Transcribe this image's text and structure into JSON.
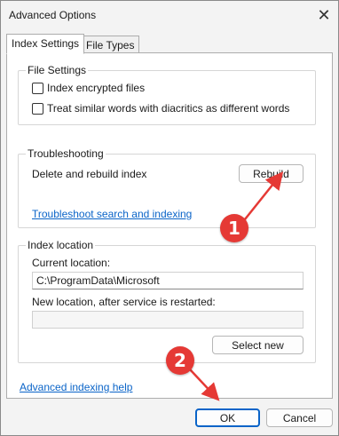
{
  "window": {
    "title": "Advanced Options",
    "close_label": "✕"
  },
  "tabs": [
    {
      "label": "Index Settings",
      "active": true
    },
    {
      "label": "File Types",
      "active": false
    }
  ],
  "file_settings": {
    "title": "File Settings",
    "options": [
      {
        "label": "Index encrypted files",
        "checked": false
      },
      {
        "label": "Treat similar words with diacritics as different words",
        "checked": false
      }
    ]
  },
  "troubleshooting": {
    "title": "Troubleshooting",
    "rebuild_text": "Delete and rebuild index",
    "rebuild_button": "Rebuild",
    "link": "Troubleshoot search and indexing"
  },
  "index_location": {
    "title": "Index location",
    "current_label": "Current location:",
    "current_value": "C:\\ProgramData\\Microsoft",
    "new_label": "New location, after service is restarted:",
    "new_value": "",
    "select_button": "Select new"
  },
  "footer": {
    "help_link": "Advanced indexing help",
    "ok_button": "OK",
    "cancel_button": "Cancel"
  },
  "annotations": {
    "marker_1": "1",
    "marker_2": "2",
    "color": "#e53935"
  }
}
